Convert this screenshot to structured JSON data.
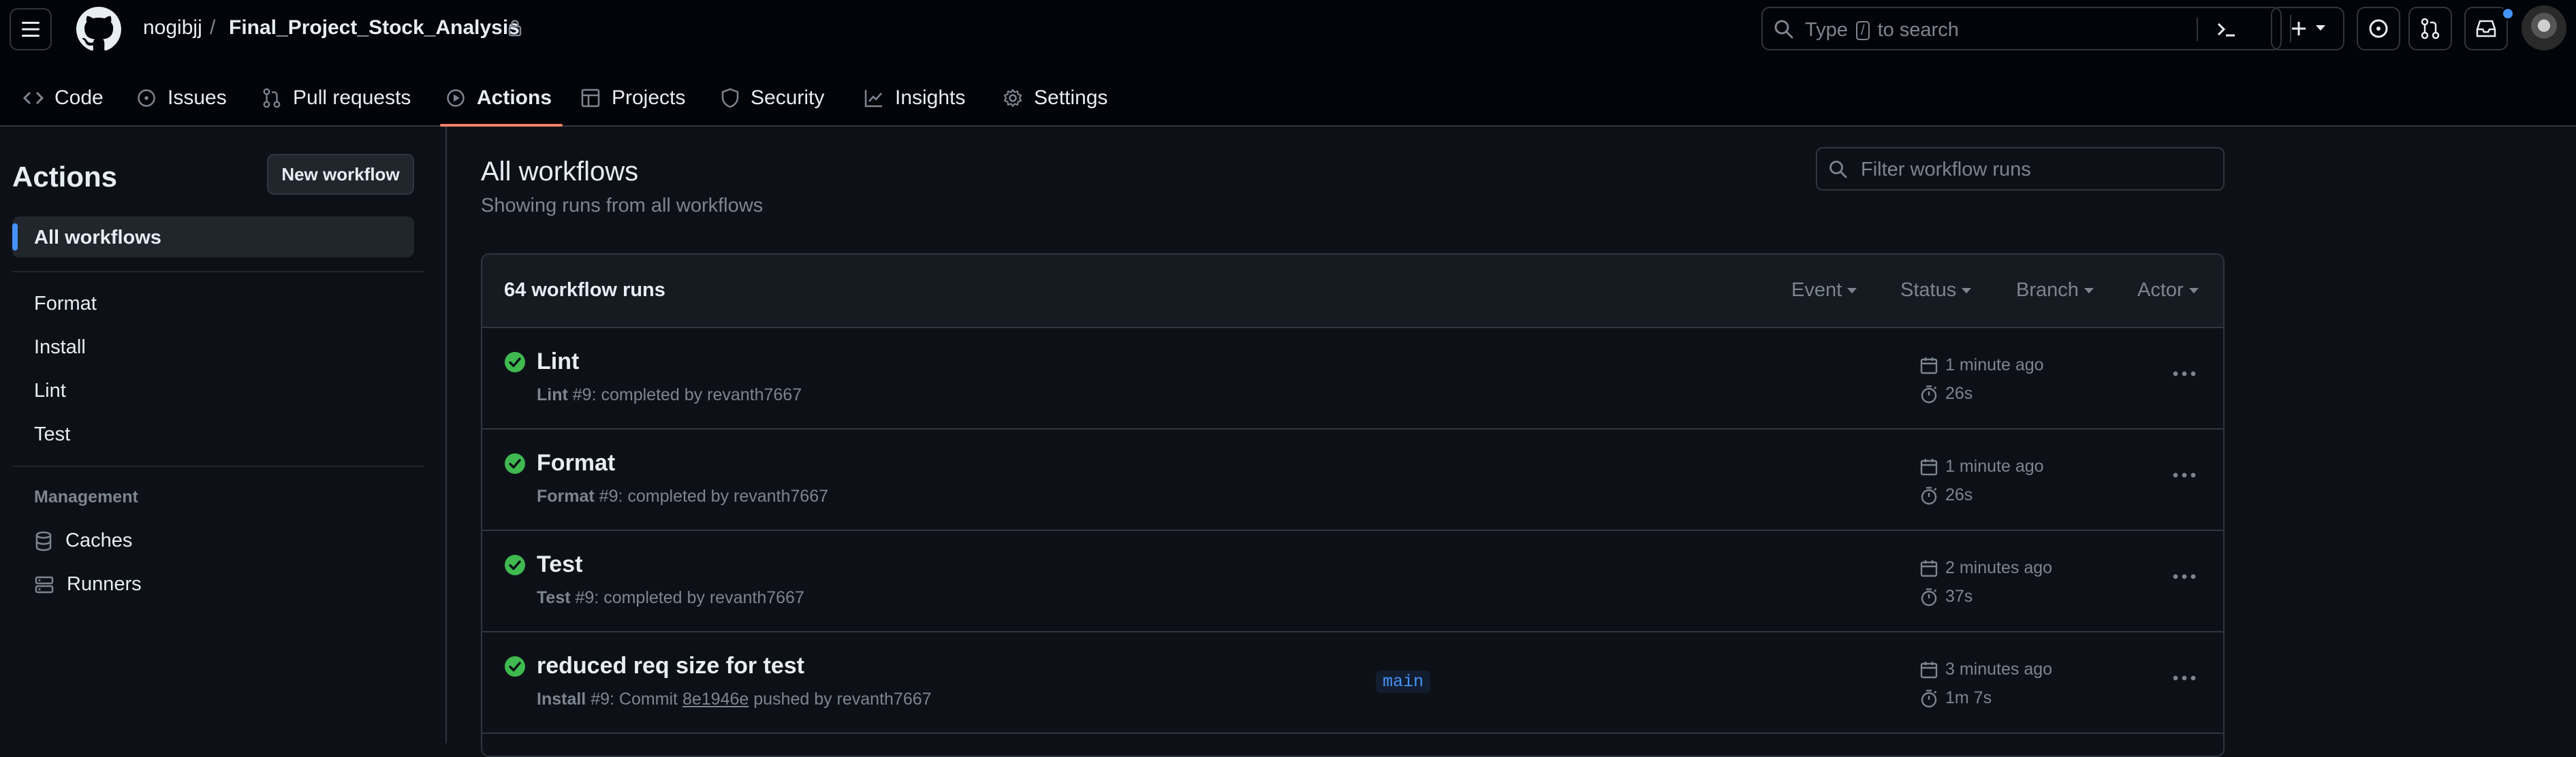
{
  "header": {
    "owner": "nogibjj",
    "separator": "/",
    "repo": "Final_Project_Stock_Analysis",
    "search": {
      "pre": "Type",
      "key": "/",
      "post": "to search"
    }
  },
  "tabs": [
    {
      "label": "Code",
      "icon": "code-icon"
    },
    {
      "label": "Issues",
      "icon": "issue-opened-icon"
    },
    {
      "label": "Pull requests",
      "icon": "git-pull-request-icon"
    },
    {
      "label": "Actions",
      "icon": "play-icon",
      "selected": true
    },
    {
      "label": "Projects",
      "icon": "table-icon"
    },
    {
      "label": "Security",
      "icon": "shield-icon"
    },
    {
      "label": "Insights",
      "icon": "graph-icon"
    },
    {
      "label": "Settings",
      "icon": "gear-icon"
    }
  ],
  "sidebar": {
    "title": "Actions",
    "new_workflow": "New workflow",
    "all_workflows": "All workflows",
    "workflows": [
      "Format",
      "Install",
      "Lint",
      "Test"
    ],
    "management_heading": "Management",
    "management": [
      {
        "label": "Caches",
        "icon": "database-icon"
      },
      {
        "label": "Runners",
        "icon": "server-icon"
      }
    ]
  },
  "main": {
    "title": "All workflows",
    "subtitle": "Showing runs from all workflows",
    "filter_placeholder": "Filter workflow runs",
    "run_count": "64 workflow runs",
    "filters": [
      "Event",
      "Status",
      "Branch",
      "Actor"
    ],
    "runs": [
      {
        "title": "Lint",
        "workflow": "Lint",
        "detail": " #9: completed by revanth7667",
        "time": "1 minute ago",
        "duration": "26s"
      },
      {
        "title": "Format",
        "workflow": "Format",
        "detail": " #9: completed by revanth7667",
        "time": "1 minute ago",
        "duration": "26s"
      },
      {
        "title": "Test",
        "workflow": "Test",
        "detail": " #9: completed by revanth7667",
        "time": "2 minutes ago",
        "duration": "37s"
      },
      {
        "title": "reduced req size for test",
        "workflow": "Install",
        "detail_pre": " #9: Commit ",
        "sha": "8e1946e",
        "detail_post": " pushed by revanth7667",
        "branch": "main",
        "time": "3 minutes ago",
        "duration": "1m 7s"
      }
    ]
  },
  "colors": {
    "accent": "#f78166",
    "success": "#3fb950",
    "link": "#4493f8",
    "background": "#0d1117"
  }
}
